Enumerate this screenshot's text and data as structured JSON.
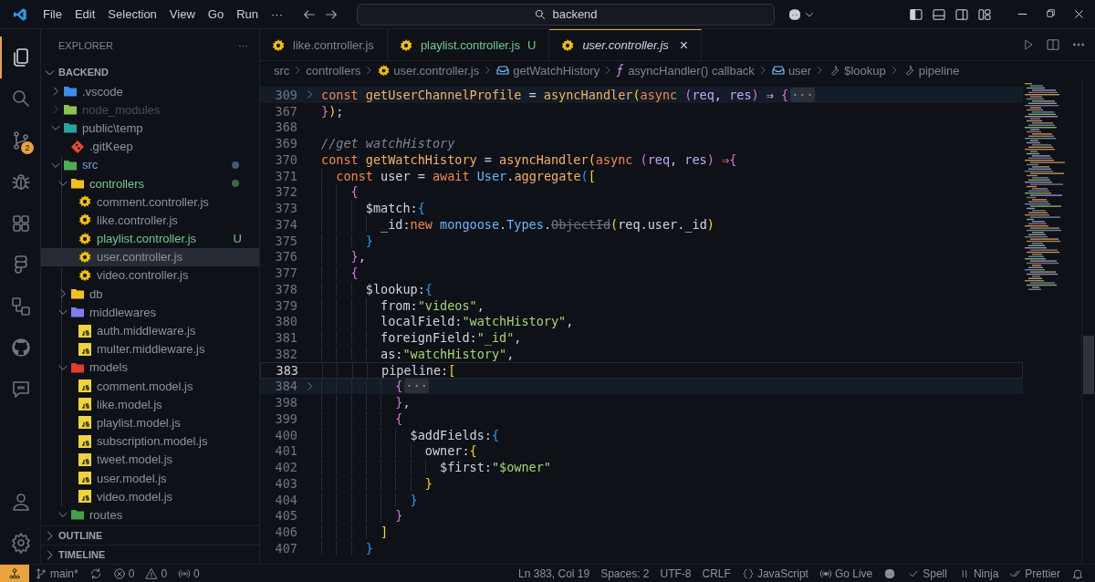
{
  "title_bar": {
    "menu": [
      "File",
      "Edit",
      "Selection",
      "View",
      "Go",
      "Run"
    ],
    "more": "···",
    "search": "backend"
  },
  "activity_bar": {
    "items": [
      {
        "kind": "explorer",
        "selected": true
      },
      {
        "kind": "search",
        "selected": false
      },
      {
        "kind": "source-control",
        "selected": false,
        "badge": "2"
      },
      {
        "kind": "debug",
        "selected": false
      },
      {
        "kind": "extensions",
        "selected": false
      },
      {
        "kind": "shapes",
        "selected": false
      },
      {
        "kind": "remote",
        "selected": false
      },
      {
        "kind": "github",
        "selected": false
      },
      {
        "kind": "chat",
        "selected": false
      }
    ],
    "bottom": [
      {
        "kind": "account",
        "selected": false
      },
      {
        "kind": "settings",
        "selected": false
      }
    ]
  },
  "sidebar": {
    "title": "EXPLORER",
    "more": "···",
    "root": {
      "label": "BACKEND",
      "expanded": true
    },
    "tree": [
      {
        "label": ".vscode",
        "kind": "folder",
        "color": "#3b8eea",
        "expanded": false,
        "dimmed": false,
        "selected": false
      },
      {
        "label": "node_modules",
        "kind": "folder",
        "color": "#8bc34a",
        "expanded": false,
        "dimmed": true,
        "selected": false
      },
      {
        "label": "public\\temp",
        "kind": "folder",
        "color": "#26a69a",
        "expanded": true,
        "dimmed": false,
        "selected": false,
        "children": [
          {
            "label": ".gitKeep",
            "kind": "git-file",
            "dimmed": false,
            "selected": false
          }
        ]
      },
      {
        "label": "src",
        "kind": "folder",
        "color": "#4caf50",
        "expanded": true,
        "dimmed": false,
        "selected": false,
        "modified": true,
        "children": [
          {
            "label": "controllers",
            "kind": "folder",
            "color": "#f2c21b",
            "expanded": true,
            "dimmed": false,
            "selected": false,
            "modified": false,
            "untracked": true,
            "children": [
              {
                "label": "comment.controller.js",
                "kind": "gear-file",
                "dimmed": false,
                "selected": false
              },
              {
                "label": "like.controller.js",
                "kind": "gear-file",
                "dimmed": false,
                "selected": false
              },
              {
                "label": "playlist.controller.js",
                "kind": "gear-file",
                "dimmed": false,
                "selected": false,
                "modified": false,
                "untracked": true,
                "badge": "U"
              },
              {
                "label": "user.controller.js",
                "kind": "gear-file",
                "dimmed": false,
                "selected": true
              },
              {
                "label": "video.controller.js",
                "kind": "gear-file",
                "dimmed": false,
                "selected": false
              }
            ]
          },
          {
            "label": "db",
            "kind": "folder",
            "color": "#f2c21b",
            "expanded": false,
            "dimmed": false,
            "selected": false
          },
          {
            "label": "middlewares",
            "kind": "folder",
            "color": "#7e7ef0",
            "expanded": true,
            "dimmed": false,
            "selected": false,
            "children": [
              {
                "label": "auth.middleware.js",
                "kind": "js-file",
                "dimmed": false,
                "selected": false
              },
              {
                "label": "multer.middleware.js",
                "kind": "js-file",
                "dimmed": false,
                "selected": false
              }
            ]
          },
          {
            "label": "models",
            "kind": "folder",
            "color": "#e53935",
            "expanded": true,
            "dimmed": false,
            "selected": false,
            "children": [
              {
                "label": "comment.model.js",
                "kind": "js-file",
                "dimmed": false,
                "selected": false
              },
              {
                "label": "like.model.js",
                "kind": "js-file",
                "dimmed": false,
                "selected": false
              },
              {
                "label": "playlist.model.js",
                "kind": "js-file",
                "dimmed": false,
                "selected": false
              },
              {
                "label": "subscription.model.js",
                "kind": "js-file",
                "dimmed": false,
                "selected": false
              },
              {
                "label": "tweet.model.js",
                "kind": "js-file",
                "dimmed": false,
                "selected": false
              },
              {
                "label": "user.model.js",
                "kind": "js-file",
                "dimmed": false,
                "selected": false
              },
              {
                "label": "video.model.js",
                "kind": "js-file",
                "dimmed": false,
                "selected": false
              }
            ]
          },
          {
            "label": "routes",
            "kind": "folder",
            "color": "#43a047",
            "expanded": true,
            "dimmed": false,
            "selected": false
          }
        ]
      }
    ],
    "sections": [
      {
        "label": "OUTLINE",
        "expanded": false
      },
      {
        "label": "TIMELINE",
        "expanded": false
      }
    ]
  },
  "tabs": [
    {
      "label": "like.controller.js",
      "selected": false,
      "preview": false
    },
    {
      "label": "playlist.controller.js",
      "selected": false,
      "preview": false,
      "badge": "U",
      "untracked": true
    },
    {
      "label": "user.controller.js",
      "selected": true,
      "preview": true,
      "close": "×"
    }
  ],
  "breadcrumbs": [
    {
      "kind": "folder",
      "text": "src"
    },
    {
      "kind": "folder",
      "text": "controllers"
    },
    {
      "kind": "gear-file",
      "text": "user.controller.js"
    },
    {
      "kind": "variable",
      "text": "getWatchHistory"
    },
    {
      "kind": "function",
      "text": "asyncHandler() callback"
    },
    {
      "kind": "variable",
      "text": "user"
    },
    {
      "kind": "property",
      "text": "$lookup"
    },
    {
      "kind": "property",
      "text": "pipeline"
    }
  ],
  "code": {
    "lines": [
      {
        "number": "309",
        "folded": true,
        "current": false,
        "tokens": [
          {
            "kind": "keyword",
            "text": "const "
          },
          {
            "kind": "function",
            "text": "getUserChannelProfile"
          },
          {
            "kind": "operator",
            "text": " = "
          },
          {
            "kind": "function",
            "text": "asyncHandler"
          },
          {
            "kind": "bracket1",
            "text": "("
          },
          {
            "kind": "keyword",
            "text": "async "
          },
          {
            "kind": "bracket2",
            "text": "("
          },
          {
            "kind": "param",
            "text": "req"
          },
          {
            "kind": "plain",
            "text": ", "
          },
          {
            "kind": "param",
            "text": "res"
          },
          {
            "kind": "bracket2",
            "text": ")"
          },
          {
            "kind": "operator",
            "text": " ⇒ "
          },
          {
            "kind": "bracket2",
            "text": "{"
          },
          {
            "kind": "fold",
            "text": "···"
          }
        ]
      },
      {
        "number": "367",
        "folded": false,
        "current": false,
        "tokens": [
          {
            "kind": "bracket2",
            "text": "}"
          },
          {
            "kind": "bracket1",
            "text": ")"
          },
          {
            "kind": "plain",
            "text": ";"
          }
        ]
      },
      {
        "number": "368",
        "folded": false,
        "current": false
      },
      {
        "number": "369",
        "folded": false,
        "current": false,
        "tokens": [
          {
            "kind": "comment",
            "text": "//get watchHistory"
          }
        ]
      },
      {
        "number": "370",
        "folded": false,
        "current": false,
        "tokens": [
          {
            "kind": "keyword",
            "text": "const "
          },
          {
            "kind": "function",
            "text": "getWatchHistory"
          },
          {
            "kind": "operator",
            "text": " = "
          },
          {
            "kind": "function",
            "text": "asyncHandler"
          },
          {
            "kind": "bracket1",
            "text": "("
          },
          {
            "kind": "keyword",
            "text": "async "
          },
          {
            "kind": "bracket2",
            "text": "("
          },
          {
            "kind": "param",
            "text": "req"
          },
          {
            "kind": "plain",
            "text": ", "
          },
          {
            "kind": "param",
            "text": "res"
          },
          {
            "kind": "bracket2",
            "text": ")"
          },
          {
            "kind": "arrow",
            "text": " ⇒"
          },
          {
            "kind": "bracket2",
            "text": "{"
          }
        ]
      },
      {
        "number": "371",
        "folded": false,
        "current": false,
        "tokens": [
          {
            "kind": "keyword",
            "text": "  const "
          },
          {
            "kind": "variable",
            "text": "user"
          },
          {
            "kind": "operator",
            "text": " = "
          },
          {
            "kind": "keyword",
            "text": "await "
          },
          {
            "kind": "class",
            "text": "User"
          },
          {
            "kind": "plain",
            "text": "."
          },
          {
            "kind": "function",
            "text": "aggregate"
          },
          {
            "kind": "bracket3",
            "text": "("
          },
          {
            "kind": "bracket1",
            "text": "["
          }
        ]
      },
      {
        "number": "372",
        "folded": false,
        "current": false,
        "tokens": [
          {
            "kind": "bracket2",
            "text": "    {"
          }
        ]
      },
      {
        "number": "373",
        "folded": false,
        "current": false,
        "tokens": [
          {
            "kind": "property",
            "text": "      $match"
          },
          {
            "kind": "plain",
            "text": ":"
          },
          {
            "kind": "bracket3",
            "text": "{"
          }
        ]
      },
      {
        "number": "374",
        "folded": false,
        "current": false,
        "tokens": [
          {
            "kind": "property",
            "text": "        _id"
          },
          {
            "kind": "plain",
            "text": ":"
          },
          {
            "kind": "keyword",
            "text": "new "
          },
          {
            "kind": "class",
            "text": "mongoose"
          },
          {
            "kind": "plain",
            "text": "."
          },
          {
            "kind": "class",
            "text": "Types"
          },
          {
            "kind": "plain",
            "text": "."
          },
          {
            "kind": "deprecated",
            "text": "ObjectId"
          },
          {
            "kind": "bracket1",
            "text": "("
          },
          {
            "kind": "variable",
            "text": "req"
          },
          {
            "kind": "plain",
            "text": "."
          },
          {
            "kind": "variable",
            "text": "user"
          },
          {
            "kind": "plain",
            "text": "."
          },
          {
            "kind": "variable",
            "text": "_id"
          },
          {
            "kind": "bracket1",
            "text": ")"
          }
        ]
      },
      {
        "number": "375",
        "folded": false,
        "current": false,
        "tokens": [
          {
            "kind": "bracket3",
            "text": "      }"
          }
        ]
      },
      {
        "number": "376",
        "folded": false,
        "current": false,
        "tokens": [
          {
            "kind": "bracket2",
            "text": "    }"
          },
          {
            "kind": "plain",
            "text": ","
          }
        ]
      },
      {
        "number": "377",
        "folded": false,
        "current": false,
        "tokens": [
          {
            "kind": "bracket2",
            "text": "    {"
          }
        ]
      },
      {
        "number": "378",
        "folded": false,
        "current": false,
        "tokens": [
          {
            "kind": "property",
            "text": "      $lookup"
          },
          {
            "kind": "plain",
            "text": ":"
          },
          {
            "kind": "bracket3",
            "text": "{"
          }
        ]
      },
      {
        "number": "379",
        "folded": false,
        "current": false,
        "tokens": [
          {
            "kind": "property",
            "text": "        from"
          },
          {
            "kind": "plain",
            "text": ":"
          },
          {
            "kind": "string",
            "text": "\"videos\""
          },
          {
            "kind": "plain",
            "text": ","
          }
        ]
      },
      {
        "number": "380",
        "folded": false,
        "current": false,
        "tokens": [
          {
            "kind": "property",
            "text": "        localField"
          },
          {
            "kind": "plain",
            "text": ":"
          },
          {
            "kind": "string",
            "text": "\"watchHistory\""
          },
          {
            "kind": "plain",
            "text": ","
          }
        ]
      },
      {
        "number": "381",
        "folded": false,
        "current": false,
        "tokens": [
          {
            "kind": "property",
            "text": "        foreignField"
          },
          {
            "kind": "plain",
            "text": ":"
          },
          {
            "kind": "string",
            "text": "\"_id\""
          },
          {
            "kind": "plain",
            "text": ","
          }
        ]
      },
      {
        "number": "382",
        "folded": false,
        "current": false,
        "tokens": [
          {
            "kind": "property",
            "text": "        as"
          },
          {
            "kind": "plain",
            "text": ":"
          },
          {
            "kind": "string",
            "text": "\"watchHistory\""
          },
          {
            "kind": "plain",
            "text": ","
          }
        ]
      },
      {
        "number": "383",
        "folded": false,
        "current": true,
        "tokens": [
          {
            "kind": "property",
            "text": "        pipeline"
          },
          {
            "kind": "plain",
            "text": ":"
          },
          {
            "kind": "bracket1",
            "text": "["
          }
        ]
      },
      {
        "number": "384",
        "folded": true,
        "current": false,
        "tokens": [
          {
            "kind": "bracket2",
            "text": "          {"
          },
          {
            "kind": "fold",
            "text": "···"
          }
        ]
      },
      {
        "number": "398",
        "folded": false,
        "current": false,
        "tokens": [
          {
            "kind": "bracket2",
            "text": "          }"
          },
          {
            "kind": "plain",
            "text": ","
          }
        ]
      },
      {
        "number": "399",
        "folded": false,
        "current": false,
        "tokens": [
          {
            "kind": "bracket2",
            "text": "          {"
          }
        ]
      },
      {
        "number": "400",
        "folded": false,
        "current": false,
        "tokens": [
          {
            "kind": "property",
            "text": "            $addFields"
          },
          {
            "kind": "plain",
            "text": ":"
          },
          {
            "kind": "bracket3",
            "text": "{"
          }
        ]
      },
      {
        "number": "401",
        "folded": false,
        "current": false,
        "tokens": [
          {
            "kind": "property",
            "text": "              owner"
          },
          {
            "kind": "plain",
            "text": ":"
          },
          {
            "kind": "bracket1",
            "text": "{"
          }
        ]
      },
      {
        "number": "402",
        "folded": false,
        "current": false,
        "tokens": [
          {
            "kind": "property",
            "text": "                $first"
          },
          {
            "kind": "plain",
            "text": ":"
          },
          {
            "kind": "string",
            "text": "\"$owner\""
          }
        ]
      },
      {
        "number": "403",
        "folded": false,
        "current": false,
        "tokens": [
          {
            "kind": "bracket1",
            "text": "              }"
          }
        ]
      },
      {
        "number": "404",
        "folded": false,
        "current": false,
        "tokens": [
          {
            "kind": "bracket3",
            "text": "            }"
          }
        ]
      },
      {
        "number": "405",
        "folded": false,
        "current": false,
        "tokens": [
          {
            "kind": "bracket2",
            "text": "          }"
          }
        ]
      },
      {
        "number": "406",
        "folded": false,
        "current": false,
        "tokens": [
          {
            "kind": "bracket1",
            "text": "        ]"
          }
        ]
      },
      {
        "number": "407",
        "folded": false,
        "current": false,
        "tokens": [
          {
            "kind": "bracket3",
            "text": "      }"
          }
        ]
      }
    ]
  },
  "status_bar": {
    "left": [
      {
        "kind": "remote"
      },
      {
        "kind": "branch",
        "text": "main*"
      },
      {
        "kind": "sync"
      },
      {
        "kind": "errors",
        "text": "0"
      },
      {
        "kind": "warnings",
        "text": "0"
      },
      {
        "kind": "ports",
        "text": "0"
      }
    ],
    "right": [
      {
        "kind": "text",
        "text": "Ln 383, Col 19"
      },
      {
        "kind": "text",
        "text": "Spaces: 2"
      },
      {
        "kind": "text",
        "text": "UTF-8"
      },
      {
        "kind": "text",
        "text": "CRLF"
      },
      {
        "kind": "language",
        "text": "JavaScript"
      },
      {
        "kind": "live",
        "text": "Go Live"
      },
      {
        "kind": "copilot"
      },
      {
        "kind": "check",
        "text": "Spell"
      },
      {
        "kind": "pause",
        "text": "Ninja"
      },
      {
        "kind": "checks",
        "text": "Prettier"
      },
      {
        "kind": "bell"
      }
    ]
  }
}
